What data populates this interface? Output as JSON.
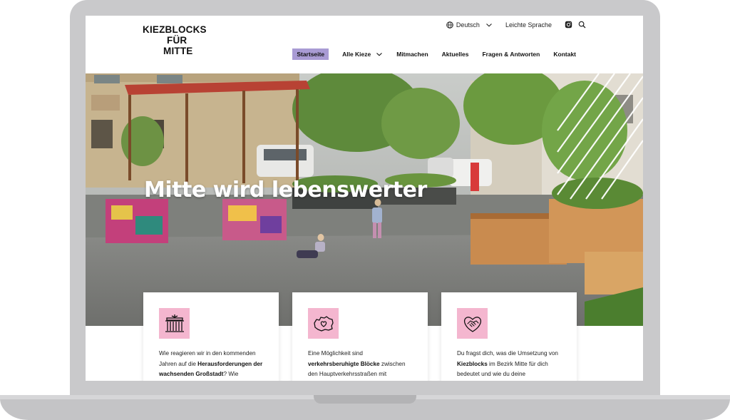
{
  "brand": {
    "logo_lines": [
      "KIEZBLOCKS",
      "FÜR",
      "MITTE"
    ]
  },
  "utility": {
    "language": "Deutsch",
    "easy_language": "Leichte Sprache",
    "icons": [
      "globe-icon",
      "chevron-down-icon",
      "instagram-icon",
      "search-icon"
    ]
  },
  "nav": {
    "items": [
      {
        "label": "Startseite",
        "active": true
      },
      {
        "label": "Alle Kieze",
        "has_dropdown": true
      },
      {
        "label": "Mitmachen"
      },
      {
        "label": "Aktuelles"
      },
      {
        "label": "Fragen & Antworten"
      },
      {
        "label": "Kontakt"
      }
    ]
  },
  "hero": {
    "title": "Mitte wird lebenswerter"
  },
  "cards": [
    {
      "icon": "brandenburg-gate-icon",
      "text_parts": [
        "Wie reagieren wir in den kommenden Jahren auf die ",
        "Herausforderungen der wachsenden Großstadt",
        "? Wie"
      ]
    },
    {
      "icon": "berlin-map-heart-icon",
      "text_parts": [
        "Eine Möglichkeit sind ",
        "verkehrsberuhigte Blöcke",
        " zwischen den Hauptverkehrsstraßen mit"
      ]
    },
    {
      "icon": "handshake-heart-icon",
      "text_parts": [
        "Du fragst dich, was die Umsetzung von ",
        "Kiezblocks",
        " im Bezirk Mitte für dich bedeutet und wie du deine"
      ]
    }
  ],
  "colors": {
    "nav_active": "#a99bd4",
    "card_icon_bg": "#f4b6cf",
    "laptop_frame": "#c9c9cb"
  }
}
